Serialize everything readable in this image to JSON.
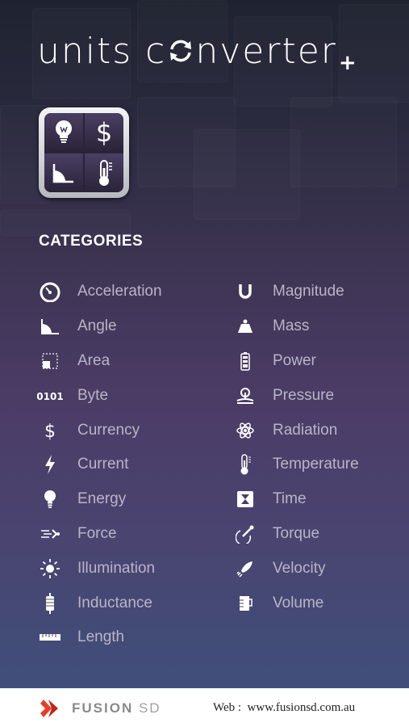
{
  "header": {
    "title_start": "units c",
    "title_end": "nverter",
    "title_plus": "+"
  },
  "section": {
    "heading": "CATEGORIES"
  },
  "categories_left": [
    {
      "label": "Acceleration",
      "icon": "gauge-icon"
    },
    {
      "label": "Angle",
      "icon": "angle-icon"
    },
    {
      "label": "Area",
      "icon": "area-icon"
    },
    {
      "label": "Byte",
      "icon": "byte-icon"
    },
    {
      "label": "Currency",
      "icon": "dollar-icon"
    },
    {
      "label": "Current",
      "icon": "lightning-icon"
    },
    {
      "label": "Energy",
      "icon": "lightbulb-icon"
    },
    {
      "label": "Force",
      "icon": "force-icon"
    },
    {
      "label": "Illumination",
      "icon": "sun-icon"
    },
    {
      "label": "Inductance",
      "icon": "inductor-icon"
    },
    {
      "label": "Length",
      "icon": "ruler-icon"
    }
  ],
  "categories_right": [
    {
      "label": "Magnitude",
      "icon": "magnet-icon"
    },
    {
      "label": "Mass",
      "icon": "weight-icon"
    },
    {
      "label": "Power",
      "icon": "battery-icon"
    },
    {
      "label": "Pressure",
      "icon": "pressure-icon"
    },
    {
      "label": "Radiation",
      "icon": "atom-icon"
    },
    {
      "label": "Temperature",
      "icon": "thermometer-icon"
    },
    {
      "label": "Time",
      "icon": "hourglass-icon"
    },
    {
      "label": "Torque",
      "icon": "torque-icon"
    },
    {
      "label": "Velocity",
      "icon": "rocket-icon"
    },
    {
      "label": "Volume",
      "icon": "beaker-icon"
    }
  ],
  "footer": {
    "brand": "FUSION",
    "brand_suffix": "SD",
    "web_label": "Web :",
    "web_url": "www.fusionsd.com.au"
  },
  "colors": {
    "label": "#b9b5c8",
    "heading": "#ffffff",
    "footer_bg": "#ffffff",
    "brand_red": "#e2402a"
  }
}
